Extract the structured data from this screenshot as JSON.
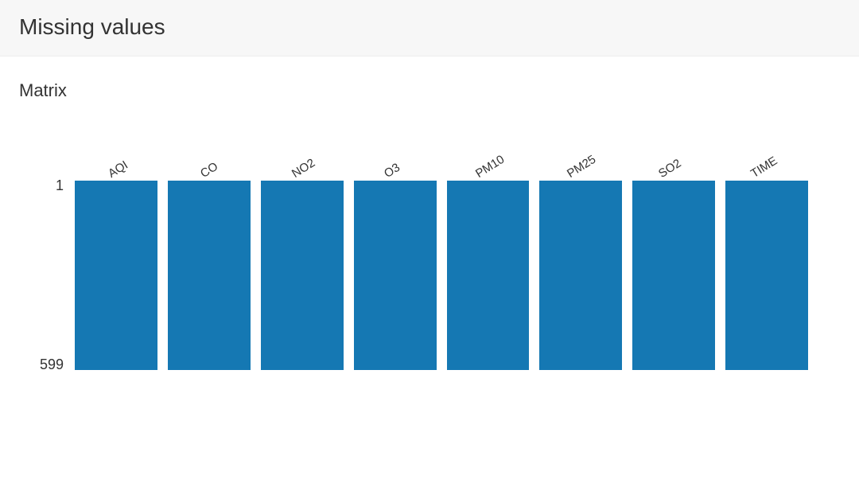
{
  "header": {
    "title": "Missing values"
  },
  "subtitle": "Matrix",
  "chart_data": {
    "type": "bar",
    "categories": [
      "AQI",
      "CO",
      "NO2",
      "O3",
      "PM10",
      "PM25",
      "SO2",
      "TIME"
    ],
    "values": [
      599,
      599,
      599,
      599,
      599,
      599,
      599,
      599
    ],
    "title": "Matrix",
    "xlabel": "",
    "ylabel": "",
    "ylim": [
      1,
      599
    ],
    "y_ticks": [
      "1",
      "599"
    ],
    "bar_color": "#1578b3"
  }
}
